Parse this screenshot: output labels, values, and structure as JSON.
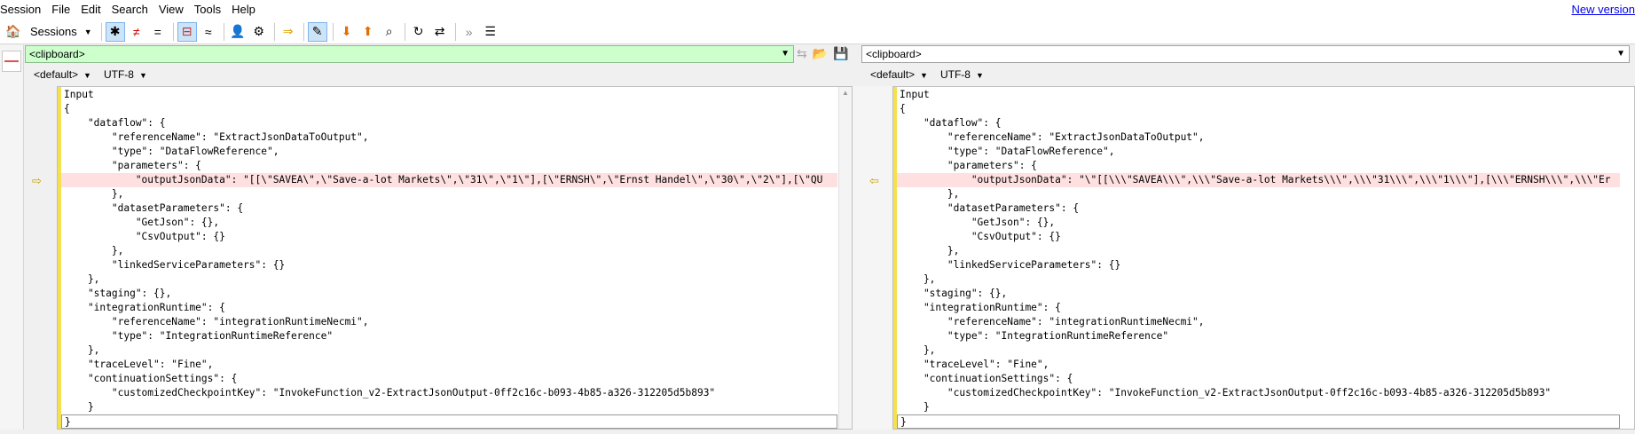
{
  "menu": [
    "Session",
    "File",
    "Edit",
    "Search",
    "View",
    "Tools",
    "Help"
  ],
  "new_version": "New version",
  "toolbar": {
    "sessions_label": "Sessions"
  },
  "left": {
    "path": "<clipboard>",
    "encoding_default": "<default>",
    "encoding": "UTF-8"
  },
  "right": {
    "path": "<clipboard>",
    "encoding_default": "<default>",
    "encoding": "UTF-8"
  },
  "left_lines": [
    "Input",
    "{",
    "    \"dataflow\": {",
    "        \"referenceName\": \"ExtractJsonDataToOutput\",",
    "        \"type\": \"DataFlowReference\",",
    "        \"parameters\": {",
    "            \"outputJsonData\": \"[[\\\"SAVEA\\\",\\\"Save-a-lot Markets\\\",\\\"31\\\",\\\"1\\\"],[\\\"ERNSH\\\",\\\"Ernst Handel\\\",\\\"30\\\",\\\"2\\\"],[\\\"QU",
    "        },",
    "        \"datasetParameters\": {",
    "            \"GetJson\": {},",
    "            \"CsvOutput\": {}",
    "        },",
    "        \"linkedServiceParameters\": {}",
    "    },",
    "    \"staging\": {},",
    "    \"integrationRuntime\": {",
    "        \"referenceName\": \"integrationRuntimeNecmi\",",
    "        \"type\": \"IntegrationRuntimeReference\"",
    "    },",
    "    \"traceLevel\": \"Fine\",",
    "    \"continuationSettings\": {",
    "        \"customizedCheckpointKey\": \"InvokeFunction_v2-ExtractJsonOutput-0ff2c16c-b093-4b85-a326-312205d5b893\"",
    "    }",
    "}"
  ],
  "right_lines": [
    "Input",
    "{",
    "    \"dataflow\": {",
    "        \"referenceName\": \"ExtractJsonDataToOutput\",",
    "        \"type\": \"DataFlowReference\",",
    "        \"parameters\": {",
    "            \"outputJsonData\": \"\\\"[[\\\\\\\"SAVEA\\\\\\\",\\\\\\\"Save-a-lot Markets\\\\\\\",\\\\\\\"31\\\\\\\",\\\\\\\"1\\\\\\\"],[\\\\\\\"ERNSH\\\\\\\",\\\\\\\"Er",
    "        },",
    "        \"datasetParameters\": {",
    "            \"GetJson\": {},",
    "            \"CsvOutput\": {}",
    "        },",
    "        \"linkedServiceParameters\": {}",
    "    },",
    "    \"staging\": {},",
    "    \"integrationRuntime\": {",
    "        \"referenceName\": \"integrationRuntimeNecmi\",",
    "        \"type\": \"IntegrationRuntimeReference\"",
    "    },",
    "    \"traceLevel\": \"Fine\",",
    "    \"continuationSettings\": {",
    "        \"customizedCheckpointKey\": \"InvokeFunction_v2-ExtractJsonOutput-0ff2c16c-b093-4b85-a326-312205d5b893\"",
    "    }",
    "}"
  ],
  "diff_line_index": 6
}
